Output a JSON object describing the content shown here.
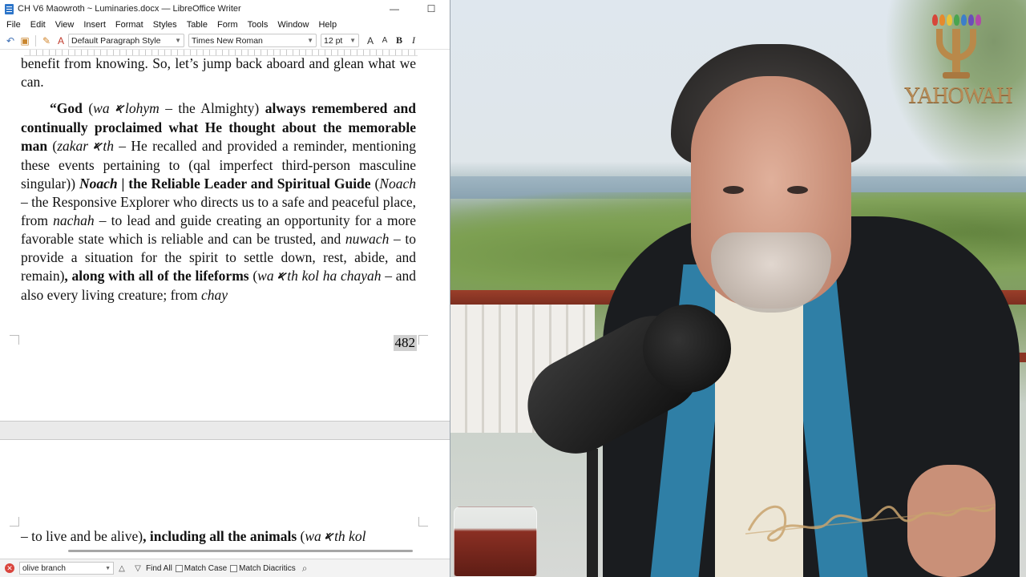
{
  "window": {
    "title": "CH V6 Maowroth ~ Luminaries.docx — LibreOffice Writer",
    "minimize": "—",
    "maximize": "☐"
  },
  "menu": [
    "File",
    "Edit",
    "View",
    "Insert",
    "Format",
    "Styles",
    "Table",
    "Form",
    "Tools",
    "Window",
    "Help"
  ],
  "toolbar": {
    "paragraph_style": "Default Paragraph Style",
    "font_name": "Times New Roman",
    "font_size": "12 pt",
    "bold": "B",
    "italic": "I"
  },
  "document": {
    "top_fragment": "benefit from knowing. So, let’s jump back aboard and glean what we can.",
    "para": {
      "s1": "“God",
      "s2": " (",
      "s3": "wa ",
      "s4": "lohym",
      "s5": " – the Almighty) ",
      "s6": "always remembered and continually proclaimed what He thought about the memorable man",
      "s7": " (",
      "s8": "zakar ",
      "s9": "th",
      "s10": " – He recalled and provided a reminder, mentioning these events pertaining to (qal imperfect third-person masculine singular)) ",
      "s11": "Noach",
      "s12": " | the Reliable Leader and Spiritual Guide",
      "s13": " (",
      "s14": "Noach",
      "s15": " – the Responsive Explorer who directs us to a safe and peaceful place, from ",
      "s16": "nachah",
      "s17": " – to lead and guide creating an opportunity for a more favorable state which is reliable and can be trusted, and ",
      "s18": "nuwach",
      "s19": " – to provide a situation for the spirit to settle down, rest, abide, and remain)",
      "s20": ", along with all of the lifeforms",
      "s21": " (",
      "s22": "wa",
      "s23": "th kol ha chayah",
      "s24": " – and also every living creature; from ",
      "s25": "chay"
    },
    "aleph_glyph": "𐤀",
    "page_number": "482",
    "next_page": {
      "s1": "– to live and be alive)",
      "s2": ", including all the animals",
      "s3": " (",
      "s4": "wa ",
      "s5": "th kol"
    }
  },
  "find_toolbar": {
    "search_value": "olive branch",
    "find_all": "Find All",
    "match_case": "Match Case",
    "match_diacritics": "Match Diacritics"
  },
  "video": {
    "logo_text": "YAHOWAH",
    "flame_colors": [
      "#d7463a",
      "#e58a2e",
      "#e9c23a",
      "#4aa44f",
      "#3d7fc9",
      "#6b4fb8",
      "#b04aa8"
    ]
  },
  "colors": {
    "libreoffice_blue": "#2d75c9",
    "shirt_stripe": "#2f7fa6",
    "logo_gold": "#b68a55"
  }
}
